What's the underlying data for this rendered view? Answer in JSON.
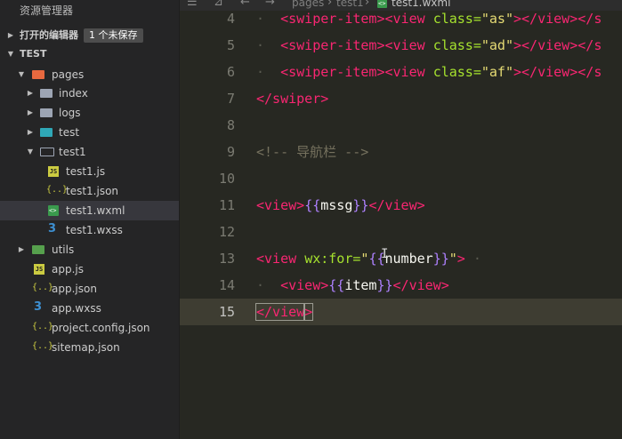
{
  "sidebar": {
    "title": "资源管理器",
    "open_editors": {
      "label": "打开的编辑器",
      "badge": "1 个未保存"
    },
    "project": "TEST",
    "tree": [
      {
        "label": "pages",
        "icon": "folder-pages-icon"
      },
      {
        "label": "index",
        "icon": "folder-icon"
      },
      {
        "label": "logs",
        "icon": "folder-icon"
      },
      {
        "label": "test",
        "icon": "folder-test-icon"
      },
      {
        "label": "test1",
        "icon": "folder-open-icon"
      },
      {
        "label": "test1.js",
        "icon": "js-file-icon"
      },
      {
        "label": "test1.json",
        "icon": "json-file-icon"
      },
      {
        "label": "test1.wxml",
        "icon": "wxml-file-icon"
      },
      {
        "label": "test1.wxss",
        "icon": "css-file-icon"
      },
      {
        "label": "utils",
        "icon": "folder-utils-icon"
      },
      {
        "label": "app.js",
        "icon": "js-file-icon"
      },
      {
        "label": "app.json",
        "icon": "json-file-icon"
      },
      {
        "label": "app.wxss",
        "icon": "css-file-icon"
      },
      {
        "label": "project.config.json",
        "icon": "json-file-icon"
      },
      {
        "label": "sitemap.json",
        "icon": "json-file-icon"
      }
    ]
  },
  "breadcrumb": {
    "items": [
      "pages",
      "test1",
      "test1.wxml"
    ]
  },
  "editor": {
    "lines": [
      {
        "num": "4",
        "tok": [
          "<swiper-item>",
          "<view ",
          "class=",
          "\"as\"",
          "></view></",
          "s"
        ]
      },
      {
        "num": "5",
        "tok": [
          "<swiper-item>",
          "<view ",
          "class=",
          "\"ad\"",
          "></view></",
          "s"
        ]
      },
      {
        "num": "6",
        "tok": [
          "<swiper-item>",
          "<view ",
          "class=",
          "\"af\"",
          "></view></",
          "s"
        ]
      },
      {
        "num": "7",
        "tok": [
          "</swiper>"
        ]
      },
      {
        "num": "8",
        "tok": []
      },
      {
        "num": "9",
        "tok": [
          "<!-- 导航栏 -->"
        ]
      },
      {
        "num": "10",
        "tok": []
      },
      {
        "num": "11",
        "tok": [
          "<view>",
          "{{",
          "mssg",
          "}}",
          "</view>"
        ]
      },
      {
        "num": "12",
        "tok": []
      },
      {
        "num": "13",
        "tok": [
          "<view ",
          "wx:for=",
          "\"",
          "{{",
          "number",
          "}}",
          "\"",
          ">"
        ]
      },
      {
        "num": "14",
        "tok": [
          "<view>",
          "{{",
          "item",
          "}}",
          "</view>"
        ]
      },
      {
        "num": "15",
        "tok": [
          "</view",
          ">"
        ]
      }
    ]
  },
  "colors": {
    "tag": "#f92672",
    "attr": "#a6e22e",
    "string": "#e6db74",
    "brace": "#ae81ff",
    "comment": "#75715e"
  }
}
